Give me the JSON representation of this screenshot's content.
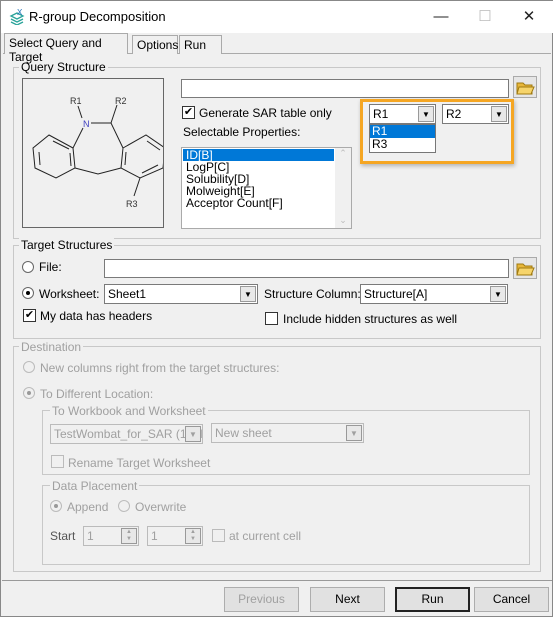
{
  "window": {
    "title": "R-group Decomposition",
    "icon": "app-logo-icon",
    "minimize": "—",
    "maximize": "☐",
    "close": "✕"
  },
  "tabs": [
    {
      "label": "Select Query and Target",
      "active": true
    },
    {
      "label": "Options"
    },
    {
      "label": "Run"
    }
  ],
  "query": {
    "group_label": "Query Structure",
    "structure_labels": {
      "r1": "R1",
      "r2": "R2",
      "r3": "R3",
      "n": "N"
    },
    "file_input": "",
    "generate_sar_label": "Generate SAR table only",
    "generate_sar_checked": true,
    "selectable_label": "Selectable Properties:",
    "properties": [
      "ID[B]",
      "LogP[C]",
      "Solubility[D]",
      "Molweight[E]",
      "Acceptor Count[F]"
    ],
    "selected_property": "ID[B]",
    "rgroup_combo1": "R1",
    "rgroup_combo2": "R2",
    "rgroup_dropdown_options": [
      "R1",
      "R3"
    ],
    "highlight_color": "#f5a623"
  },
  "target": {
    "group_label": "Target Structures",
    "file_label": "File:",
    "file_value": "",
    "worksheet_label": "Worksheet:",
    "worksheet_value": "Sheet1",
    "structure_col_label": "Structure Column:",
    "structure_col_value": "Structure[A]",
    "headers_label": "My data has headers",
    "headers_checked": true,
    "hidden_label": "Include hidden structures as well",
    "hidden_checked": false
  },
  "destination": {
    "group_label": "Destination",
    "new_columns_label": "New columns right from the target structures:",
    "different_label": "To Different Location:",
    "workbook_group": "To Workbook and Worksheet",
    "workbook_value": "TestWombat_for_SAR (1).xl",
    "sheet_value": "New sheet",
    "rename_label": "Rename Target Worksheet",
    "placement_group": "Data Placement",
    "append_label": "Append",
    "overwrite_label": "Overwrite",
    "start_label": "Start",
    "start_row": "1",
    "start_col": "1",
    "current_cell_label": "at current cell"
  },
  "buttons": {
    "previous": "Previous",
    "next": "Next",
    "run": "Run",
    "cancel": "Cancel"
  }
}
